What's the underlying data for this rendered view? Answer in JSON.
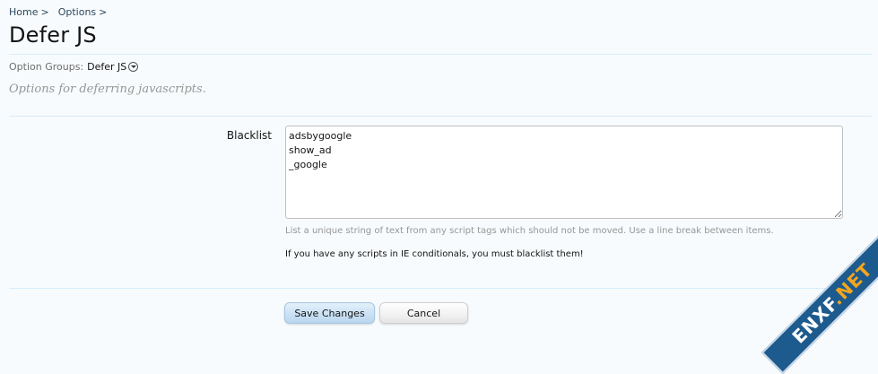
{
  "breadcrumb": {
    "items": [
      {
        "label": "Home",
        "sep": ">"
      },
      {
        "label": "Options",
        "sep": ">"
      }
    ]
  },
  "page": {
    "title": "Defer JS",
    "option_groups_label": "Option Groups:",
    "option_groups_value": "Defer JS",
    "description": "Options for deferring javascripts."
  },
  "form": {
    "blacklist_label": "Blacklist",
    "blacklist_value": "adsbygoogle\nshow_ad\n_google",
    "hint": "List a unique string of text from any script tags which should not be moved. Use a line break between items.",
    "note": "If you have any scripts in IE conditionals, you must blacklist them!"
  },
  "buttons": {
    "save_label": "Save Changes",
    "cancel_label": "Cancel"
  },
  "watermark": {
    "text_left": "ENXF",
    "text_accent": ".NET"
  },
  "icons": {
    "dropdown": "chevron-down-circle-icon"
  },
  "colors": {
    "link": "#2b485c",
    "divider": "#d7edfc",
    "save_button": "#cde3f5",
    "watermark_bg": "#1d5a8e",
    "watermark_accent": "#f3a51d"
  }
}
